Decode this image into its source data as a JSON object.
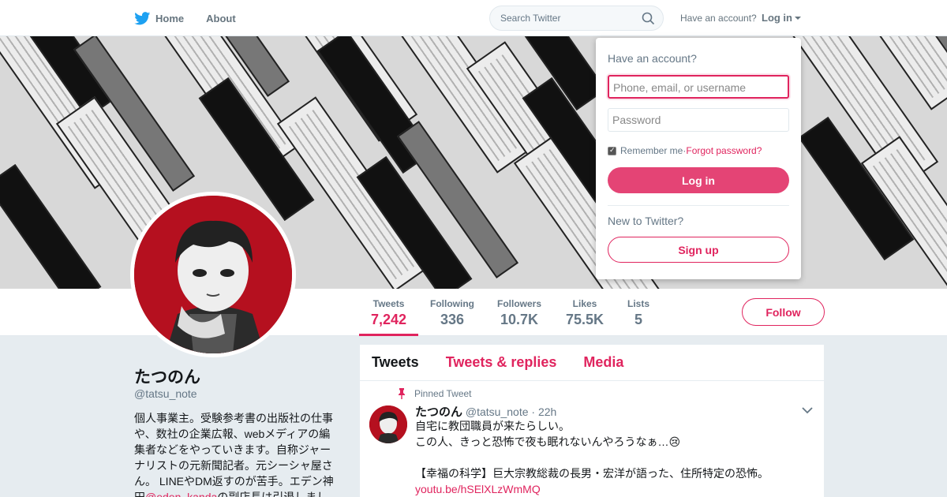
{
  "nav": {
    "home": "Home",
    "about": "About",
    "search_placeholder": "Search Twitter",
    "have_account": "Have an account?",
    "login": "Log in"
  },
  "profile": {
    "name": "たつのん",
    "handle": "@tatsu_note",
    "bio_lines": [
      "個人事業主。受験参考書の出版社の仕事",
      "や、数社の企業広報、webメディアの編",
      "集者などをやっていきます。自称ジャー",
      "ナリストの元新聞記者。元シーシャ屋さ",
      "ん。 LINEやDM返すのが苦手。エデン神"
    ],
    "bio_partial_prefix": "田",
    "bio_partial_link": "@eden_kanda",
    "bio_partial_suffix": "の副店長は引退しまし"
  },
  "stats": [
    {
      "label": "Tweets",
      "value": "7,242"
    },
    {
      "label": "Following",
      "value": "336"
    },
    {
      "label": "Followers",
      "value": "10.7K"
    },
    {
      "label": "Likes",
      "value": "75.5K"
    },
    {
      "label": "Lists",
      "value": "5"
    }
  ],
  "follow_label": "Follow",
  "tabs": [
    "Tweets",
    "Tweets & replies",
    "Media"
  ],
  "tweet": {
    "pinned_label": "Pinned Tweet",
    "author": "たつのん",
    "handle": "@tatsu_note",
    "time": "· 22h",
    "line1": "自宅に教団職員が来たらしい。",
    "line2": "この人、きっと恐怖で夜も眠れないんやろうなぁ…😢",
    "line3": "【幸福の科学】巨大宗教総裁の長男・宏洋が語った、住所特定の恐怖。",
    "link": "youtu.be/hSElXLzWmMQ"
  },
  "login_dropdown": {
    "title": "Have an account?",
    "username_placeholder": "Phone, email, or username",
    "password_placeholder": "Password",
    "remember": "Remember me",
    "separator": " · ",
    "forgot": "Forgot password?",
    "login_button": "Log in",
    "new_to": "New to Twitter?",
    "signup_button": "Sign up"
  },
  "colors": {
    "accent": "#e0245e",
    "twitter_blue": "#1da1f2",
    "avatar_red": "#b5101f"
  }
}
